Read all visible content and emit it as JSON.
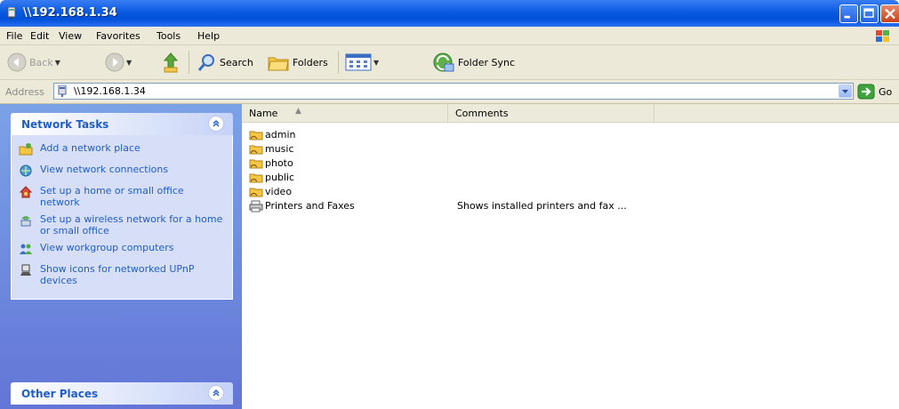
{
  "window": {
    "title": "\\\\192.168.1.34"
  },
  "menu": {
    "items": [
      "File",
      "Edit",
      "View",
      "Favorites",
      "Tools",
      "Help"
    ]
  },
  "toolbar": {
    "back_label": "Back",
    "search_label": "Search",
    "folders_label": "Folders",
    "folder_sync_label": "Folder Sync"
  },
  "address": {
    "label": "Address",
    "value": "\\\\192.168.1.34",
    "go_label": "Go"
  },
  "left_pane": {
    "network_tasks": {
      "title": "Network Tasks",
      "items": [
        {
          "label": "Add a network place",
          "icon": "add-network-place-icon"
        },
        {
          "label": "View network connections",
          "icon": "network-connections-icon"
        },
        {
          "label": "Set up a home or small office network",
          "icon": "home-network-icon"
        },
        {
          "label": "Set up a wireless network for a home or small office",
          "icon": "wireless-network-icon"
        },
        {
          "label": "View workgroup computers",
          "icon": "workgroup-computers-icon"
        },
        {
          "label": "Show icons for networked UPnP devices",
          "icon": "upnp-devices-icon"
        }
      ]
    },
    "other_places": {
      "title": "Other Places"
    }
  },
  "list": {
    "columns": [
      "Name",
      "Comments"
    ],
    "rows": [
      {
        "name": "admin",
        "comment": "",
        "icon": "shared-folder-icon"
      },
      {
        "name": "music",
        "comment": "",
        "icon": "shared-folder-icon"
      },
      {
        "name": "photo",
        "comment": "",
        "icon": "shared-folder-icon"
      },
      {
        "name": "public",
        "comment": "",
        "icon": "shared-folder-icon"
      },
      {
        "name": "video",
        "comment": "",
        "icon": "shared-folder-icon"
      },
      {
        "name": "Printers and Faxes",
        "comment": "Shows installed printers and fax ...",
        "icon": "printers-faxes-icon"
      }
    ]
  },
  "colors": {
    "title_bar": "#0a5ae0",
    "task_pane": "#6f8cdf",
    "task_panel_body": "#d6dff7",
    "link_text": "#215dc6"
  }
}
